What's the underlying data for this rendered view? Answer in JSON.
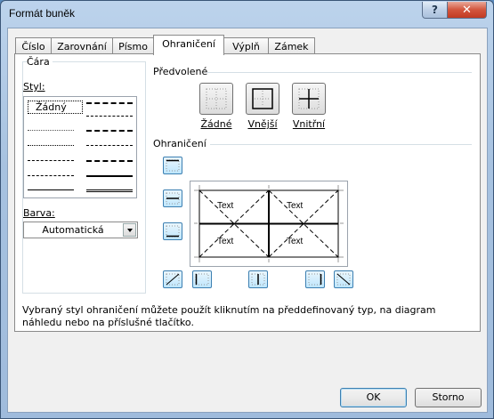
{
  "window": {
    "title": "Formát buněk",
    "help_glyph": "?",
    "close_glyph": "✕"
  },
  "tabs": [
    {
      "label": "Číslo",
      "active": false
    },
    {
      "label": "Zarovnání",
      "active": false
    },
    {
      "label": "Písmo",
      "active": false
    },
    {
      "label": "Ohraničení",
      "active": true
    },
    {
      "label": "Výplň",
      "active": false
    },
    {
      "label": "Zámek",
      "active": false
    }
  ],
  "line_group": {
    "title": "Čára",
    "style_label": "Styl:",
    "none_style": "Žádný",
    "color_label": "Barva:",
    "color_value": "Automatická"
  },
  "presets": {
    "title": "Předvolené",
    "items": [
      {
        "label": "Žádné",
        "icon": "border-none-icon"
      },
      {
        "label": "Vnější",
        "icon": "border-outline-icon"
      },
      {
        "label": "Vnitřní",
        "icon": "border-inside-icon"
      }
    ]
  },
  "border": {
    "title": "Ohraničení",
    "preview_text": [
      "Text",
      "Text",
      "Text",
      "Text"
    ]
  },
  "description": "Vybraný styl ohraničení můžete použít kliknutím na předdefinovaný typ, na diagram náhledu nebo na příslušné tlačítko.",
  "buttons": {
    "ok": "OK",
    "cancel": "Storno"
  },
  "colors": {
    "accent_border": "#3c7fb1",
    "button_fill": "#bee6fd"
  }
}
